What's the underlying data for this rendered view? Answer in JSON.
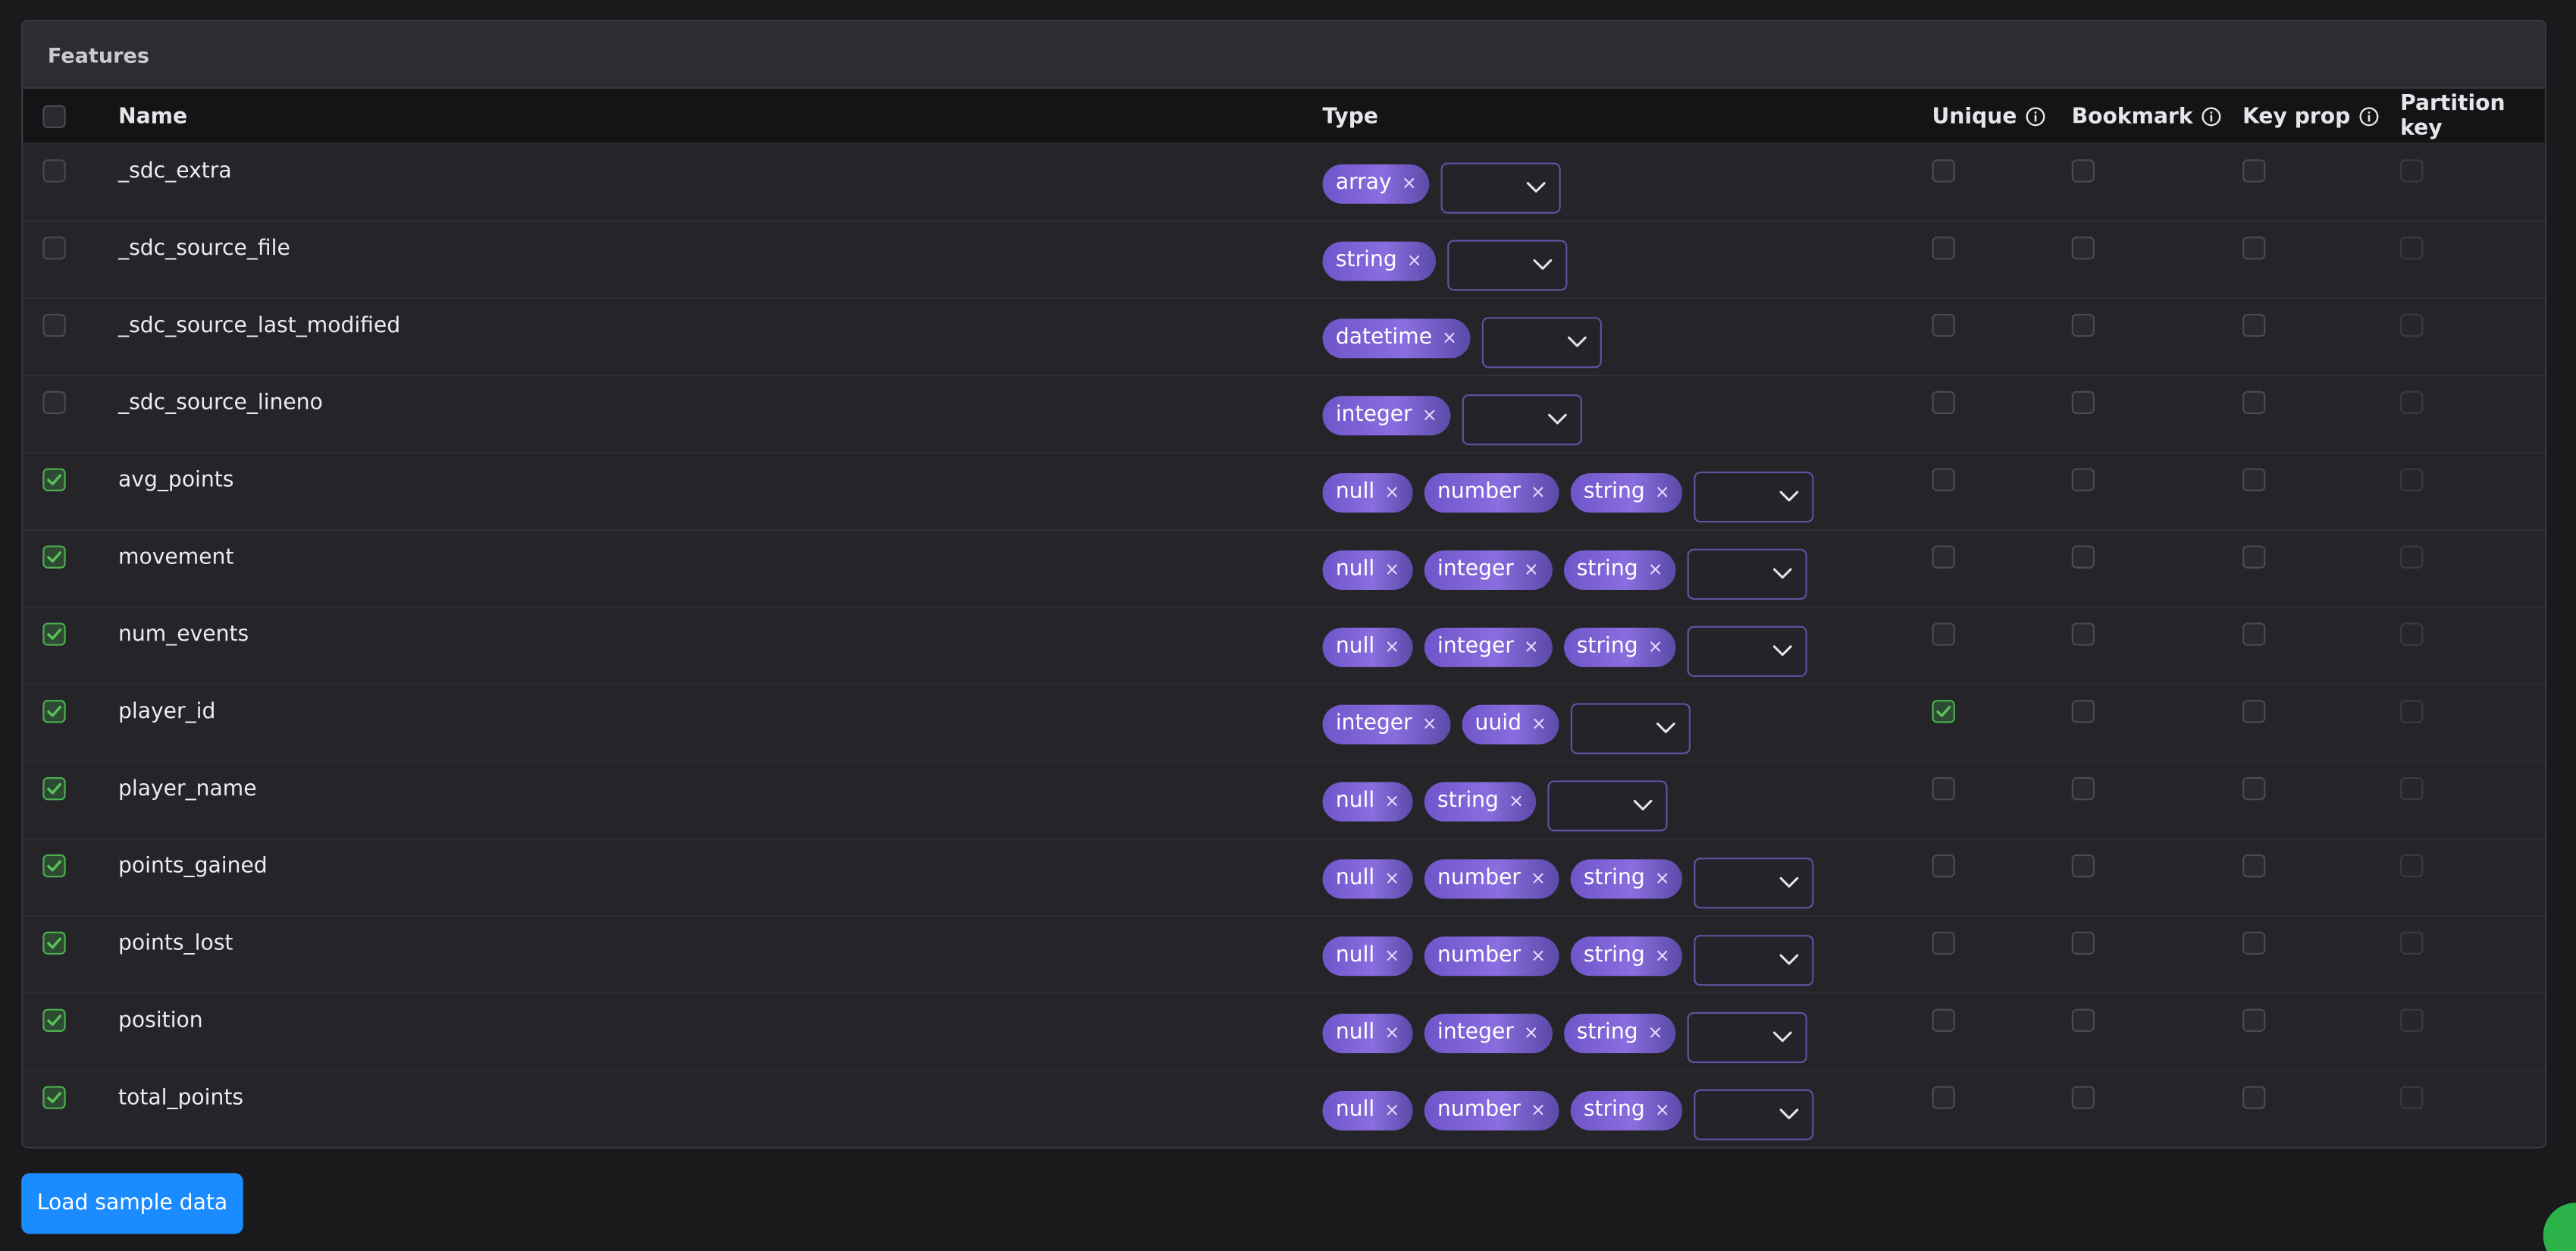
{
  "panel": {
    "title": "Features"
  },
  "columns": {
    "name": "Name",
    "type": "Type",
    "unique": "Unique",
    "bookmark": "Bookmark",
    "key_prop": "Key prop",
    "partition_key": "Partition key"
  },
  "rows": [
    {
      "name": "_sdc_extra",
      "selected": false,
      "types": [
        "array"
      ],
      "unique": false
    },
    {
      "name": "_sdc_source_file",
      "selected": false,
      "types": [
        "string"
      ],
      "unique": false
    },
    {
      "name": "_sdc_source_last_modified",
      "selected": false,
      "types": [
        "datetime"
      ],
      "unique": false
    },
    {
      "name": "_sdc_source_lineno",
      "selected": false,
      "types": [
        "integer"
      ],
      "unique": false
    },
    {
      "name": "avg_points",
      "selected": true,
      "types": [
        "null",
        "number",
        "string"
      ],
      "unique": false
    },
    {
      "name": "movement",
      "selected": true,
      "types": [
        "null",
        "integer",
        "string"
      ],
      "unique": false
    },
    {
      "name": "num_events",
      "selected": true,
      "types": [
        "null",
        "integer",
        "string"
      ],
      "unique": false
    },
    {
      "name": "player_id",
      "selected": true,
      "types": [
        "integer",
        "uuid"
      ],
      "unique": true
    },
    {
      "name": "player_name",
      "selected": true,
      "types": [
        "null",
        "string"
      ],
      "unique": false
    },
    {
      "name": "points_gained",
      "selected": true,
      "types": [
        "null",
        "number",
        "string"
      ],
      "unique": false
    },
    {
      "name": "points_lost",
      "selected": true,
      "types": [
        "null",
        "number",
        "string"
      ],
      "unique": false
    },
    {
      "name": "position",
      "selected": true,
      "types": [
        "null",
        "integer",
        "string"
      ],
      "unique": false
    },
    {
      "name": "total_points",
      "selected": true,
      "types": [
        "null",
        "number",
        "string"
      ],
      "unique": false
    }
  ],
  "tag_remove_glyph": "×",
  "actions": {
    "load_sample": "Load sample data"
  },
  "colors": {
    "accent": "#1a8cff",
    "tag": "#7b61d9",
    "check": "#4caf50"
  }
}
